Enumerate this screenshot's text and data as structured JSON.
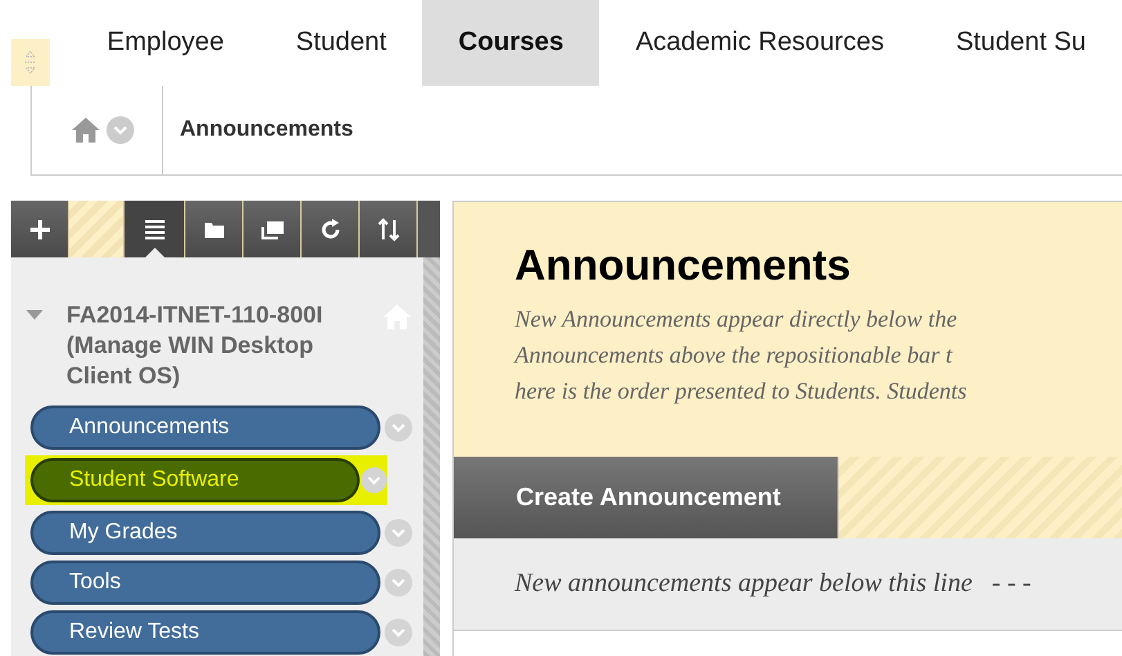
{
  "tabs": [
    {
      "label": "Employee",
      "selected": false
    },
    {
      "label": "Student",
      "selected": false
    },
    {
      "label": "Courses",
      "selected": true
    },
    {
      "label": "Academic Resources",
      "selected": false
    },
    {
      "label": "Student Su",
      "selected": false
    }
  ],
  "breadcrumb": {
    "current": "Announcements"
  },
  "toolbar": [
    {
      "kind": "add",
      "selected": false
    },
    {
      "kind": "list",
      "selected": true
    },
    {
      "kind": "folder",
      "selected": false
    },
    {
      "kind": "window",
      "selected": false
    },
    {
      "kind": "refresh",
      "selected": false
    },
    {
      "kind": "sort",
      "selected": false
    }
  ],
  "course": {
    "title": "FA2014-ITNET-110-800I (Manage WIN Desktop Client OS)",
    "expanded": true
  },
  "menu_items": [
    {
      "label": "Announcements",
      "selected": false
    },
    {
      "label": "Student Software",
      "selected": true
    },
    {
      "label": "My Grades",
      "selected": false
    },
    {
      "label": "Tools",
      "selected": false
    },
    {
      "label": "Review Tests",
      "selected": false
    }
  ],
  "content": {
    "title": "Announcements",
    "description": [
      "New Announcements appear directly below the",
      "Announcements above the repositionable bar t",
      "here is the order presented to Students. Students"
    ],
    "action_button": "Create Announcement",
    "divider_note": "New announcements appear below this line",
    "divider_dashes": "- - -"
  }
}
